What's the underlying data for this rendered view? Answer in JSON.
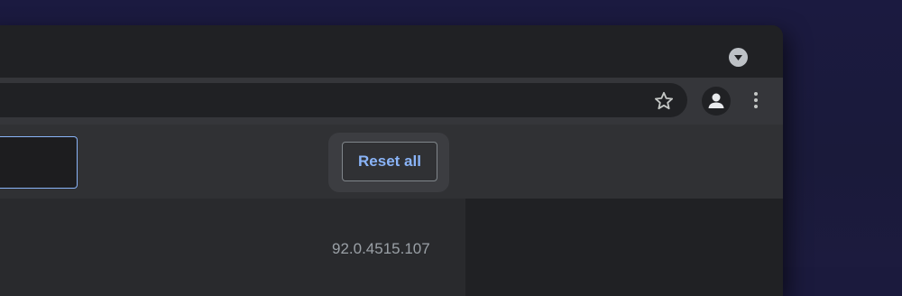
{
  "toolbar": {
    "bookmark_icon": "star-outline-icon",
    "profile_icon": "account-circle-icon",
    "menu_icon": "more-vertical-icon"
  },
  "tabstrip": {
    "tab_search_icon": "chevron-down-circle-icon"
  },
  "header": {
    "reset_label": "Reset all"
  },
  "content": {
    "version_text": "92.0.4515.107"
  },
  "colors": {
    "accent": "#8ab4f8",
    "window_bg": "#202124",
    "toolbar_bg": "#35363a",
    "header_bg": "#303134",
    "backdrop": "#1b1a3d"
  }
}
